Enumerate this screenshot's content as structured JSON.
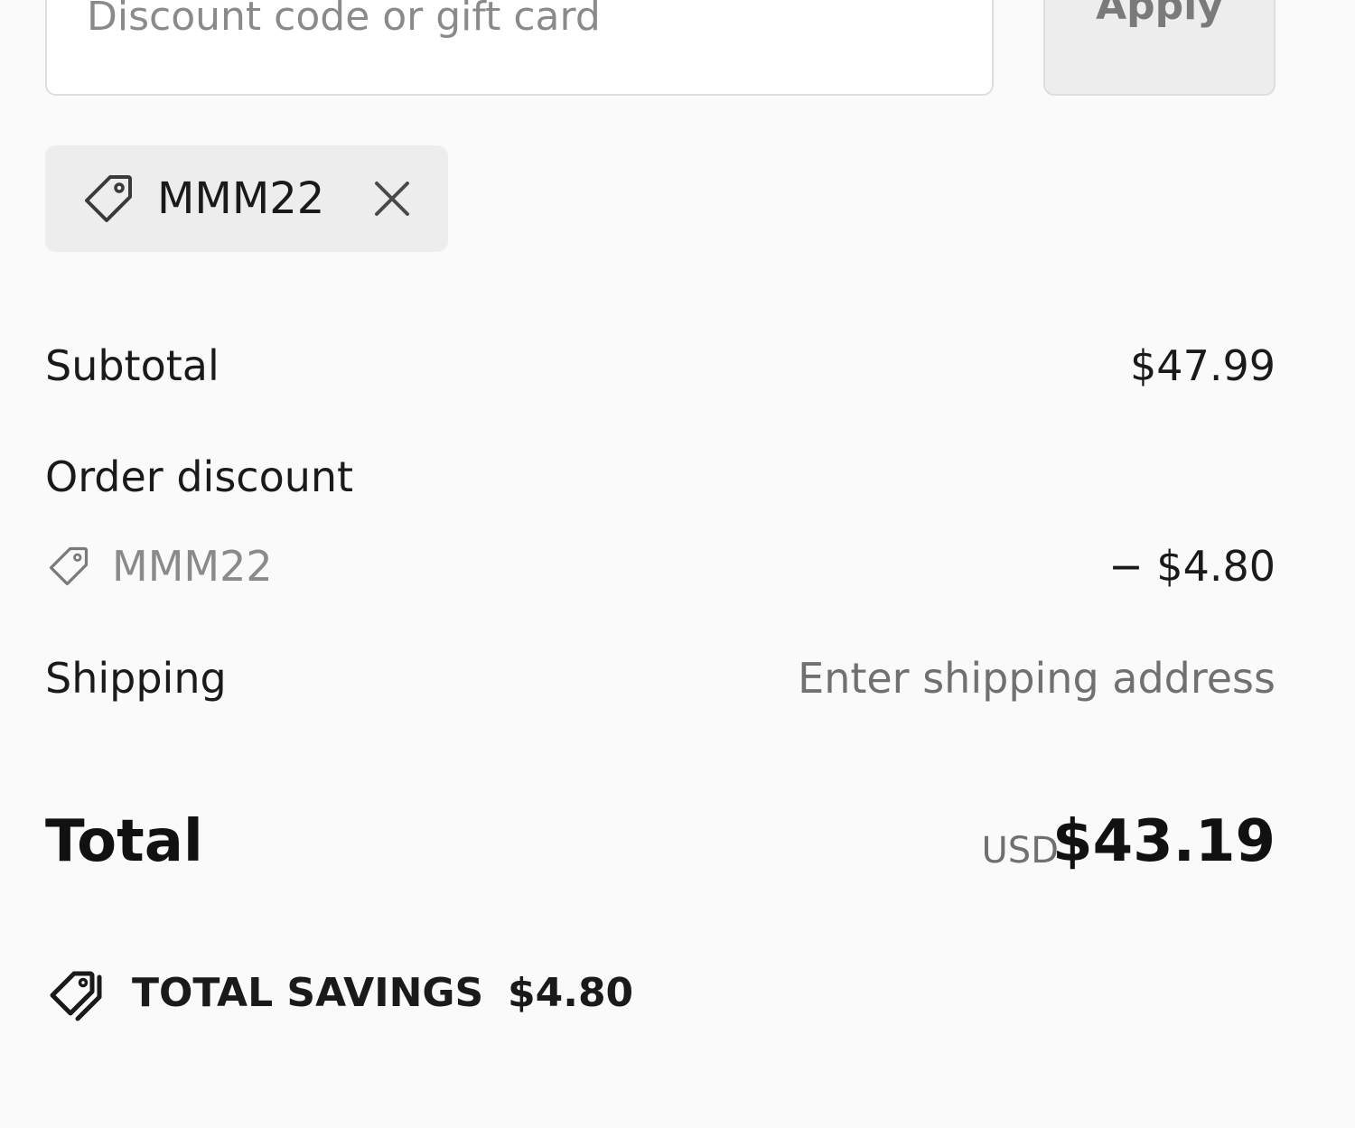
{
  "discount": {
    "input_placeholder": "Discount code or gift card",
    "input_value": "",
    "apply_label": "Apply",
    "applied_code": "MMM22",
    "remove_icon": "close-icon",
    "tag_icon": "tag-icon"
  },
  "summary": {
    "subtotal_label": "Subtotal",
    "subtotal_value": "$47.99",
    "order_discount_label": "Order discount",
    "order_discount_code": "MMM22",
    "order_discount_value": "− $4.80",
    "shipping_label": "Shipping",
    "shipping_value": "Enter shipping address",
    "total_label": "Total",
    "total_currency": "USD",
    "total_value": "$43.19",
    "savings_label": "TOTAL SAVINGS",
    "savings_value": "$4.80",
    "savings_icon": "double-tag-icon"
  },
  "colors": {
    "background": "#fafafa",
    "chip_background": "#ededed",
    "muted_text": "#707070",
    "text": "#1a1a1a"
  }
}
